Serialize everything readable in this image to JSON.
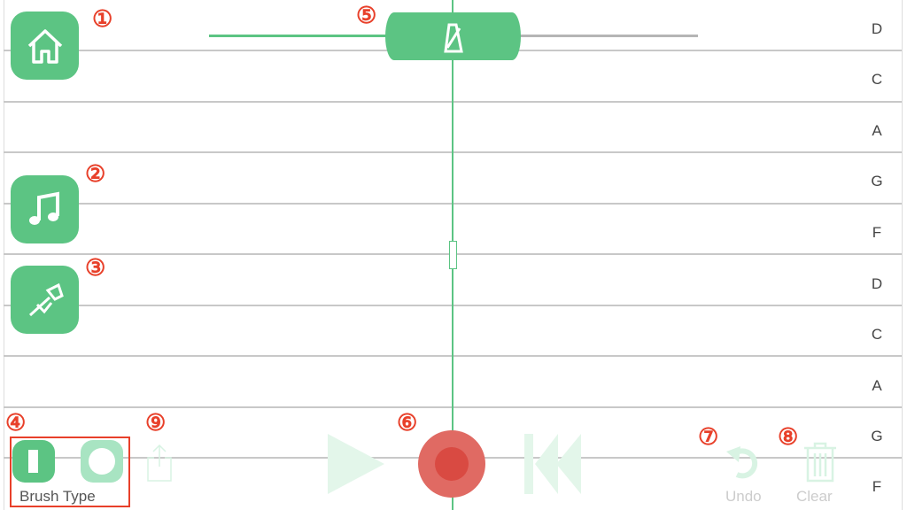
{
  "notes": [
    "D",
    "C",
    "A",
    "G",
    "F",
    "D",
    "C",
    "A",
    "G",
    "F"
  ],
  "markers": [
    "①",
    "②",
    "③",
    "④",
    "⑤",
    "⑥",
    "⑦",
    "⑧",
    "⑨"
  ],
  "brush": {
    "label": "Brush Type"
  },
  "toolbar": {
    "undo_label": "Undo",
    "clear_label": "Clear"
  },
  "tempo": {
    "level": 0.5
  },
  "colors": {
    "accent": "#5cc483",
    "record": "#e06a63",
    "marker": "#e8402a"
  }
}
